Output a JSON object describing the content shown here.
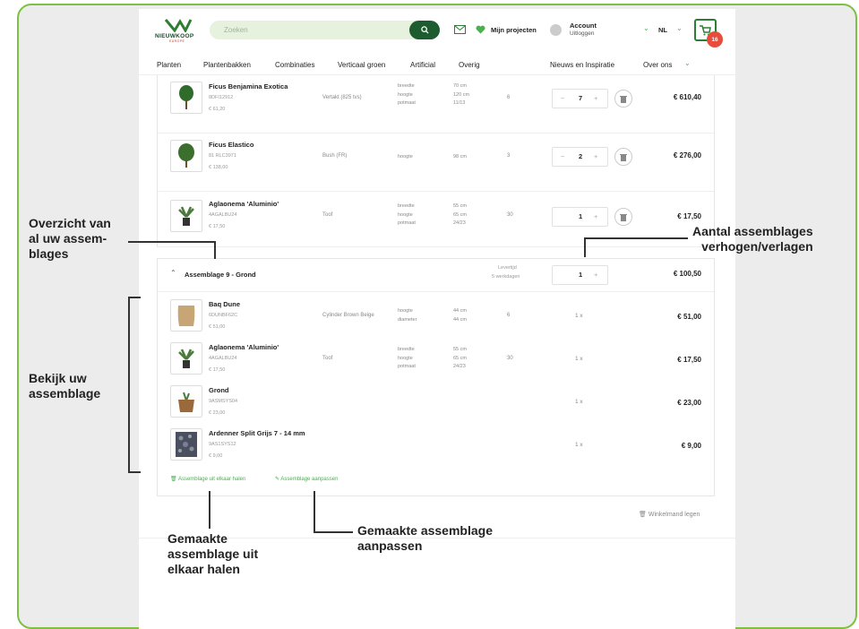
{
  "colors": {
    "frame_border": "#7cc142",
    "brand_green": "#1d5c2e",
    "accent_green": "#4caf50",
    "badge_red": "#e74c3c"
  },
  "header": {
    "logo_text": "NIEUWKOOP",
    "logo_sub": "EUROPE",
    "search_placeholder": "Zoeken",
    "mail_icon": "mail-icon",
    "projects_label": "Mijn projecten",
    "account_label": "Account",
    "logout_label": "Uitloggen",
    "language": "NL",
    "cart_count": "16"
  },
  "nav": {
    "items": [
      "Planten",
      "Plantenbakken",
      "Combinaties",
      "Verticaal groen",
      "Artificial",
      "Overig",
      "Nieuws en Inspiratie",
      "Over ons"
    ]
  },
  "products": [
    {
      "name": "Ficus Benjamina Exotica",
      "sku": "8DFI12912",
      "unit_price": "€ 61,20",
      "type": "Vertakt (825 tvs)",
      "dims": [
        "breedte",
        "hoogte",
        "potmaat"
      ],
      "dim_values": [
        "70 cm",
        "120 cm",
        "11/13"
      ],
      "qty2": "6",
      "qty": "7",
      "total": "€ 610,40"
    },
    {
      "name": "Ficus Elastico",
      "sku": "81 RLC3971",
      "unit_price": "€ 138,00",
      "type": "Bush (FR)",
      "dims": [
        "hoogte"
      ],
      "dim_values": [
        "98 cm"
      ],
      "qty2": "3",
      "qty": "2",
      "total": "€ 276,00"
    },
    {
      "name": "Aglaonema 'Aluminio'",
      "sku": "4AGALBU24",
      "unit_price": "€ 17,50",
      "type": "Toof",
      "dims": [
        "breedte",
        "hoogte",
        "potmaat"
      ],
      "dim_values": [
        "55 cm",
        "65 cm",
        "24/23"
      ],
      "qty2": "30",
      "qty": "1",
      "total": "€ 17,50"
    }
  ],
  "assembly": {
    "title": "Assemblage 9 - Grond",
    "delivery_label": "Levertijd",
    "delivery_value": "5 werkdagen",
    "qty": "1",
    "total": "€ 100,50",
    "items": [
      {
        "name": "Baq Dune",
        "sku": "6DUNBF62C",
        "unit_price": "€ 51,00",
        "type": "Cylinder Brown Beige",
        "dims": [
          "hoogte",
          "diameter"
        ],
        "dim_values": [
          "44 cm",
          "44 cm"
        ],
        "qty2": "6",
        "per": "1 x",
        "total": "€ 51,00"
      },
      {
        "name": "Aglaonema 'Aluminio'",
        "sku": "4AGALBU24",
        "unit_price": "€ 17,50",
        "type": "Toof",
        "dims": [
          "breedte",
          "hoogte",
          "potmaat"
        ],
        "dim_values": [
          "55 cm",
          "65 cm",
          "24/23"
        ],
        "qty2": "30",
        "per": "1 x",
        "total": "€ 17,50"
      },
      {
        "name": "Grond",
        "sku": "9ASMSYS04",
        "unit_price": "€ 23,00",
        "type": "",
        "dims": [],
        "dim_values": [],
        "qty2": "",
        "per": "1 x",
        "total": "€ 23,00"
      },
      {
        "name": "Ardenner Split Grijs 7 - 14 mm",
        "sku": "9AS1SYS12",
        "unit_price": "€ 9,00",
        "type": "",
        "dims": [],
        "dim_values": [],
        "qty2": "",
        "per": "1 x",
        "total": "€ 9,00"
      }
    ],
    "action_split": "Assemblage uit elkaar halen",
    "action_edit": "Assemblage aanpassen"
  },
  "empty_cart_label": "Winkelmand legen",
  "annotations": {
    "overview": [
      "Overzicht van",
      "al uw assem-",
      "blages"
    ],
    "qty": [
      "Aantal assemblages",
      "verhogen/verlagen"
    ],
    "view": [
      "Bekijk uw",
      "assemblage"
    ],
    "split": [
      "Gemaakte",
      "assemblage uit",
      "elkaar halen"
    ],
    "edit": [
      "Gemaakte assemblage",
      "aanpassen"
    ]
  }
}
